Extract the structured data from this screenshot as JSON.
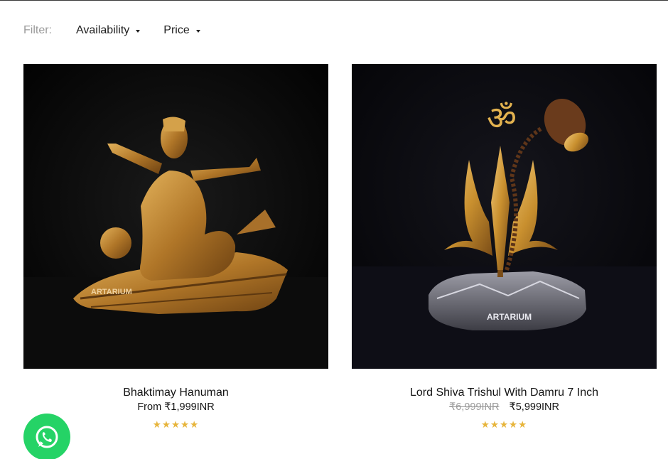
{
  "filter": {
    "label": "Filter:",
    "availability_label": "Availability",
    "price_label": "Price"
  },
  "products": [
    {
      "title": "Bhaktimay Hanuman",
      "price": "From ₹1,999INR",
      "stars": "★★★★★",
      "rating": 5,
      "image_icon": "hanuman-statue-image",
      "brand_mark": "ARTARIUM"
    },
    {
      "title": "Lord Shiva Trishul With Damru 7 Inch",
      "price_old": "₹6,999INR",
      "price": "₹5,999INR",
      "stars": "★★★★★",
      "rating": 4.5,
      "image_icon": "trishul-damru-image",
      "brand_mark": "ARTARIUM"
    }
  ],
  "colors": {
    "star": "#e7b53c",
    "whatsapp": "#25d366",
    "image_bg": "#060606",
    "gold": "#c9902f"
  },
  "whatsapp": {
    "icon": "whatsapp-icon"
  }
}
